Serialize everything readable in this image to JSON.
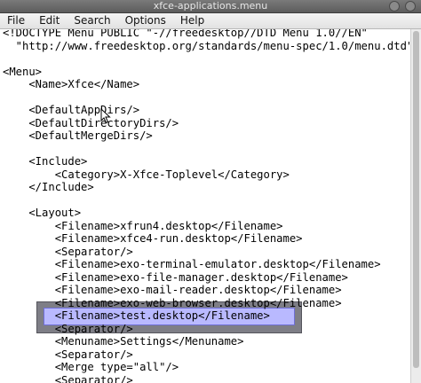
{
  "window": {
    "title": "xfce-applications.menu"
  },
  "menubar": {
    "items": [
      "File",
      "Edit",
      "Search",
      "Options",
      "Help"
    ]
  },
  "editor": {
    "lines": [
      "<!DOCTYPE Menu PUBLIC \"-//freedesktop//DTD Menu 1.0//EN\"",
      "  \"http://www.freedesktop.org/standards/menu-spec/1.0/menu.dtd\">",
      "",
      "<Menu>",
      "    <Name>Xfce</Name>",
      "",
      "    <DefaultAppDirs/>",
      "    <DefaultDirectoryDirs/>",
      "    <DefaultMergeDirs/>",
      "",
      "    <Include>",
      "        <Category>X-Xfce-Toplevel</Category>",
      "    </Include>",
      "",
      "    <Layout>",
      "        <Filename>xfrun4.desktop</Filename>",
      "        <Filename>xfce4-run.desktop</Filename>",
      "        <Separator/>",
      "        <Filename>exo-terminal-emulator.desktop</Filename>",
      "        <Filename>exo-file-manager.desktop</Filename>",
      "        <Filename>exo-mail-reader.desktop</Filename>",
      "        <Filename>exo-web-browser.desktop</Filename>",
      "        <Filename>test.desktop</Filename>",
      "        <Separator/>",
      "        <Menuname>Settings</Menuname>",
      "        <Separator/>",
      "        <Merge type=\"all\"/>",
      "        <Separator/>"
    ]
  }
}
